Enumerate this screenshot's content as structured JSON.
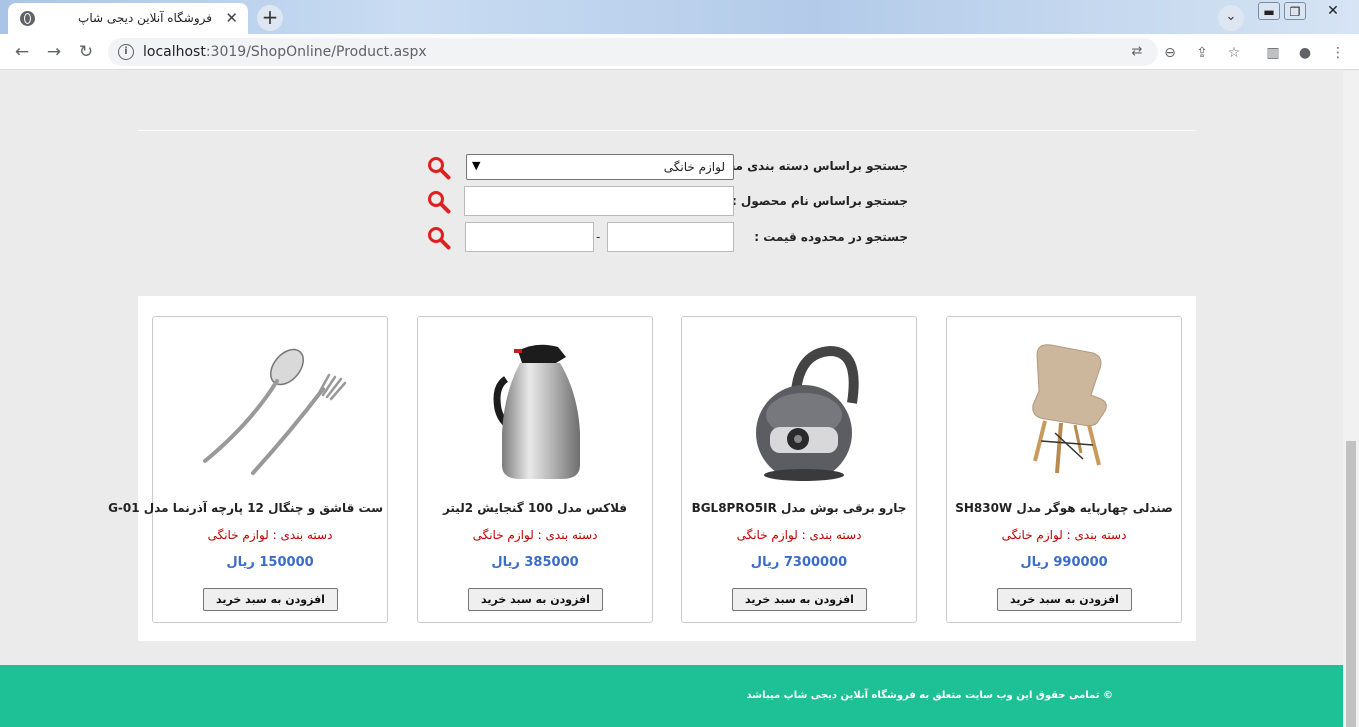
{
  "browser": {
    "tab_title": "فروشگاه آنلاین دیجی شاپ",
    "url_host": "localhost",
    "url_rest": ":3019/ShopOnline/Product.aspx"
  },
  "search": {
    "category_label": "جستجو براساس دسته بندی محصول :",
    "category_value": "لوازم خانگی",
    "name_label": "جستجو براساس نام محصول :",
    "price_label": "جستجو در محدوده قیمت :",
    "price_sep": "-"
  },
  "products": [
    {
      "name": "صندلی چهارپایه هوگر مدل SH830W",
      "category": "دسته بندی : لوازم خانگی",
      "price": "990000 ریال",
      "button": "افزودن به سبد خرید",
      "image": "chair-image"
    },
    {
      "name": "جارو برقی بوش مدل BGL8PRO5IR",
      "category": "دسته بندی : لوازم خانگی",
      "price": "7300000 ریال",
      "button": "افزودن به سبد خرید",
      "image": "vacuum-image"
    },
    {
      "name": "فلاکس مدل 100 گنجایش 2لیتر",
      "category": "دسته بندی : لوازم خانگی",
      "price": "385000 ریال",
      "button": "افزودن به سبد خرید",
      "image": "flask-image"
    },
    {
      "name": "ست قاشق و چنگال 12 پارچه آذرنما مدل G-01",
      "category": "دسته بندی : لوازم خانگی",
      "price": "150000 ریال",
      "button": "افزودن به سبد خرید",
      "image": "cutlery-image"
    }
  ],
  "footer": {
    "text": "© تمامی حقوق این وب سایت متعلق به فروشگاه آنلاین دیجی شاپ میباشد"
  },
  "colors": {
    "accent_red": "#c00000",
    "price_blue": "#3a6cc8",
    "footer_green": "#1ec196",
    "search_icon": "#e02020"
  }
}
